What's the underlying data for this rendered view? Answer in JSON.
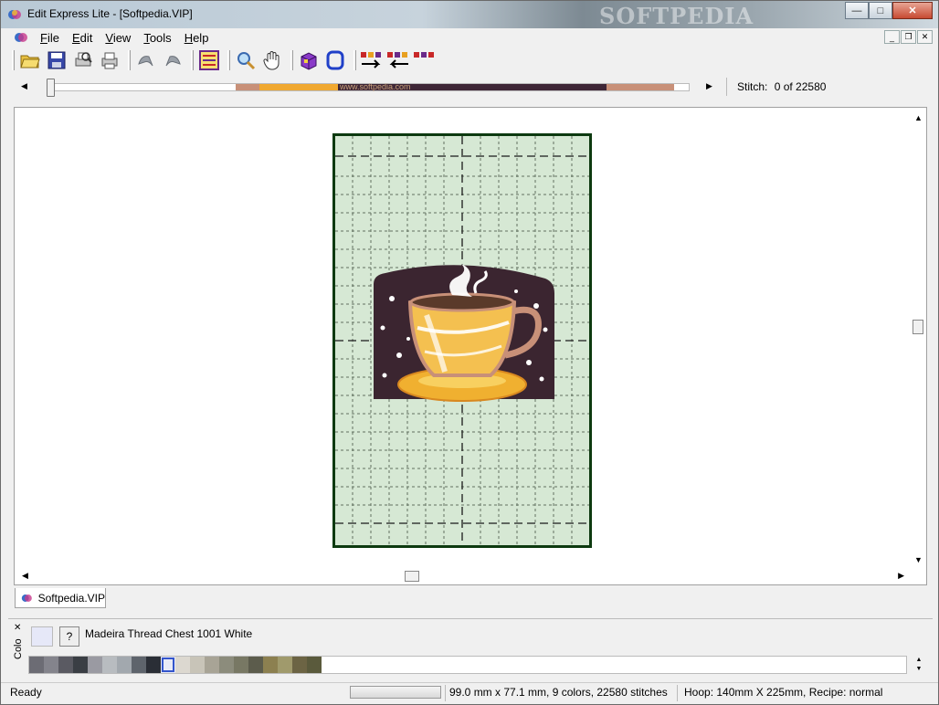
{
  "window": {
    "title": "Edit Express Lite - [Softpedia.VIP]",
    "watermark": "SOFTPEDIA",
    "controls": {
      "minimize": "—",
      "maximize": "□",
      "close": "✕"
    }
  },
  "menu": {
    "items": [
      "File",
      "Edit",
      "View",
      "Tools",
      "Help"
    ],
    "mdi_controls": {
      "minimize": "_",
      "restore": "❐",
      "close": "✕"
    }
  },
  "toolbar": {
    "buttons": [
      "open-folder-icon",
      "save-icon",
      "print-preview-icon",
      "print-icon",
      "undo-icon",
      "redo-icon",
      "color-sequence-icon",
      "zoom-icon",
      "pan-hand-icon",
      "3d-box-icon",
      "hoop-icon",
      "move-color-forward-icon",
      "move-color-backward-icon",
      "color-blocks-icon"
    ]
  },
  "stitch_slider": {
    "watermark": "www.softpedia.com",
    "stitch_label": "Stitch:",
    "stitch_value": "0 of 22580",
    "position_fraction": 0
  },
  "canvas": {
    "hoop_fill": "#d6e8d4",
    "hoop_border": "#0d3a10",
    "design_bg": "#3b2530"
  },
  "doc_tab": {
    "label": "Softpedia.VIP"
  },
  "color_panel": {
    "side_label": "Colo",
    "help_label": "?",
    "current_thread": "Madeira Thread Chest 1001 White",
    "current_color": "#e6e8f8",
    "palette": [
      "#6c6c74",
      "#84848c",
      "#5a5a62",
      "#3a3e44",
      "#9a9aa2",
      "#b8bcc0",
      "#a2a8ae",
      "#5e646c",
      "#2a2e36",
      "#e8eaf6",
      "#dcd8d0",
      "#c8c4b8",
      "#a8a496",
      "#8c8c7c",
      "#787864",
      "#5c5c4c",
      "#8c8050",
      "#a09a6c",
      "#6c6444",
      "#5a5a3c"
    ],
    "selected_index": 9
  },
  "status": {
    "ready": "Ready",
    "dimensions": "99.0 mm x 77.1 mm, 9 colors, 22580 stitches",
    "hoop": "Hoop: 140mm X 225mm, Recipe: normal"
  }
}
